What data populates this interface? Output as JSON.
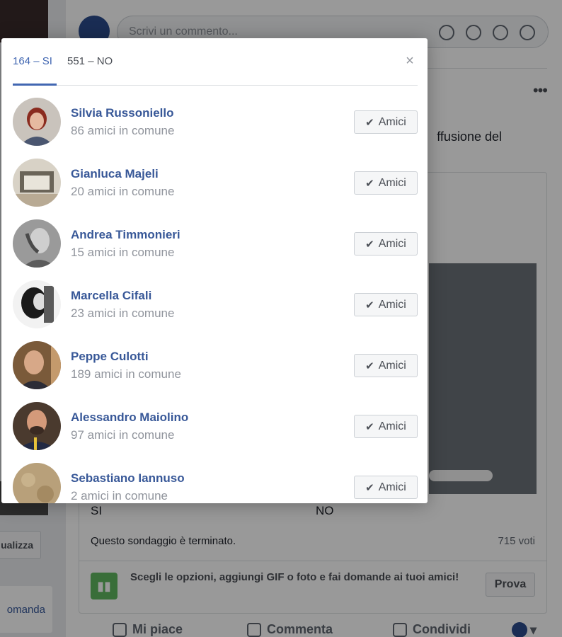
{
  "background": {
    "left_buttons": [
      "ualizza",
      "omanda"
    ],
    "comment_placeholder": "Scrivi un commento...",
    "post_text_fragment": "ffusione del",
    "poll": {
      "option_yes": "SI",
      "option_no": "NO",
      "status": "Questo sondaggio è terminato.",
      "votes": "715 voti"
    },
    "promo": {
      "text": "Scegli le opzioni, aggiungi GIF o foto e fai domande ai tuoi amici!",
      "button": "Prova"
    },
    "actions": {
      "like": "Mi piace",
      "comment": "Commenta",
      "share": "Condividi"
    }
  },
  "dialog": {
    "tabs": [
      {
        "label": "164 – SI",
        "active": true
      },
      {
        "label": "551 – NO",
        "active": false
      }
    ],
    "close_label": "×",
    "friend_button_label": "Amici",
    "people": [
      {
        "name": "Silvia Russoniello",
        "mutual": "86 amici in comune"
      },
      {
        "name": "Gianluca Majeli",
        "mutual": "20 amici in comune"
      },
      {
        "name": "Andrea Timmonieri",
        "mutual": "15 amici in comune"
      },
      {
        "name": "Marcella Cifali",
        "mutual": "23 amici in comune"
      },
      {
        "name": "Peppe Culotti",
        "mutual": "189 amici in comune"
      },
      {
        "name": "Alessandro Maiolino",
        "mutual": "97 amici in comune"
      },
      {
        "name": "Sebastiano Iannuso",
        "mutual": "2 amici in comune"
      }
    ]
  },
  "colors": {
    "link_blue": "#385898",
    "tab_active": "#4267b2",
    "muted": "#90949c"
  }
}
